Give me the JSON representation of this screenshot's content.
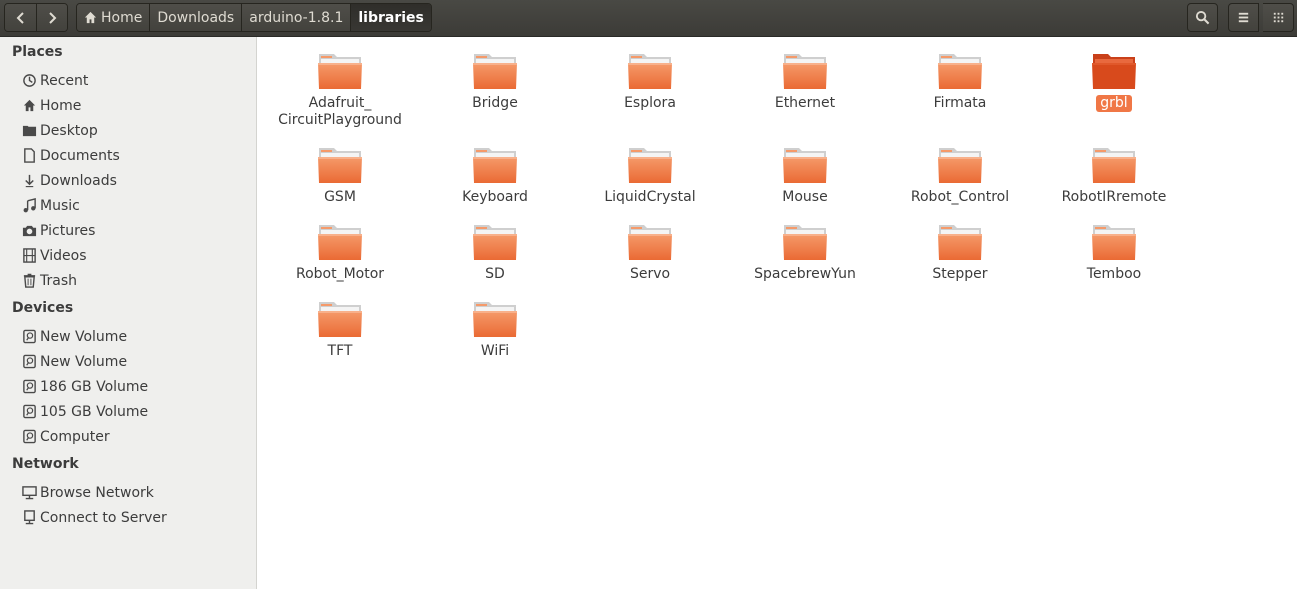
{
  "nav": {
    "back_icon": "chevron-left-icon",
    "forward_icon": "chevron-right-icon"
  },
  "breadcrumbs": [
    "Home",
    "Downloads",
    "arduino-1.8.1",
    "libraries"
  ],
  "toolbar": {
    "search_icon": "search-icon",
    "list_view_icon": "list-view-icon",
    "grid_view_icon": "grid-view-icon"
  },
  "sidebar": {
    "places_title": "Places",
    "places": [
      {
        "label": "Recent",
        "icon": "clock-icon"
      },
      {
        "label": "Home",
        "icon": "home-icon"
      },
      {
        "label": "Desktop",
        "icon": "desktop-icon"
      },
      {
        "label": "Documents",
        "icon": "document-icon"
      },
      {
        "label": "Downloads",
        "icon": "download-icon"
      },
      {
        "label": "Music",
        "icon": "music-icon"
      },
      {
        "label": "Pictures",
        "icon": "camera-icon"
      },
      {
        "label": "Videos",
        "icon": "film-icon"
      },
      {
        "label": "Trash",
        "icon": "trash-icon"
      }
    ],
    "devices_title": "Devices",
    "devices": [
      {
        "label": "New Volume",
        "icon": "drive-icon"
      },
      {
        "label": "New Volume",
        "icon": "drive-icon"
      },
      {
        "label": "186 GB Volume",
        "icon": "drive-icon"
      },
      {
        "label": "105 GB Volume",
        "icon": "drive-icon"
      },
      {
        "label": "Computer",
        "icon": "drive-icon"
      }
    ],
    "network_title": "Network",
    "network": [
      {
        "label": "Browse Network",
        "icon": "network-icon"
      },
      {
        "label": "Connect to Server",
        "icon": "server-icon"
      }
    ]
  },
  "folders": [
    {
      "name": "Adafruit_\nCircuitPlayground",
      "selected": false
    },
    {
      "name": "Bridge",
      "selected": false
    },
    {
      "name": "Esplora",
      "selected": false
    },
    {
      "name": "Ethernet",
      "selected": false
    },
    {
      "name": "Firmata",
      "selected": false
    },
    {
      "name": "grbl",
      "selected": true
    },
    {
      "name": "GSM",
      "selected": false
    },
    {
      "name": "Keyboard",
      "selected": false
    },
    {
      "name": "LiquidCrystal",
      "selected": false
    },
    {
      "name": "Mouse",
      "selected": false
    },
    {
      "name": "Robot_Control",
      "selected": false
    },
    {
      "name": "RobotIRremote",
      "selected": false
    },
    {
      "name": "Robot_Motor",
      "selected": false
    },
    {
      "name": "SD",
      "selected": false
    },
    {
      "name": "Servo",
      "selected": false
    },
    {
      "name": "SpacebrewYun",
      "selected": false
    },
    {
      "name": "Stepper",
      "selected": false
    },
    {
      "name": "Temboo",
      "selected": false
    },
    {
      "name": "TFT",
      "selected": false
    },
    {
      "name": "WiFi",
      "selected": false
    }
  ],
  "colors": {
    "folder_body": "#ea6a34",
    "folder_light": "#f59a6a",
    "folder_selected": "#d84a1c",
    "selection": "#f07746"
  }
}
